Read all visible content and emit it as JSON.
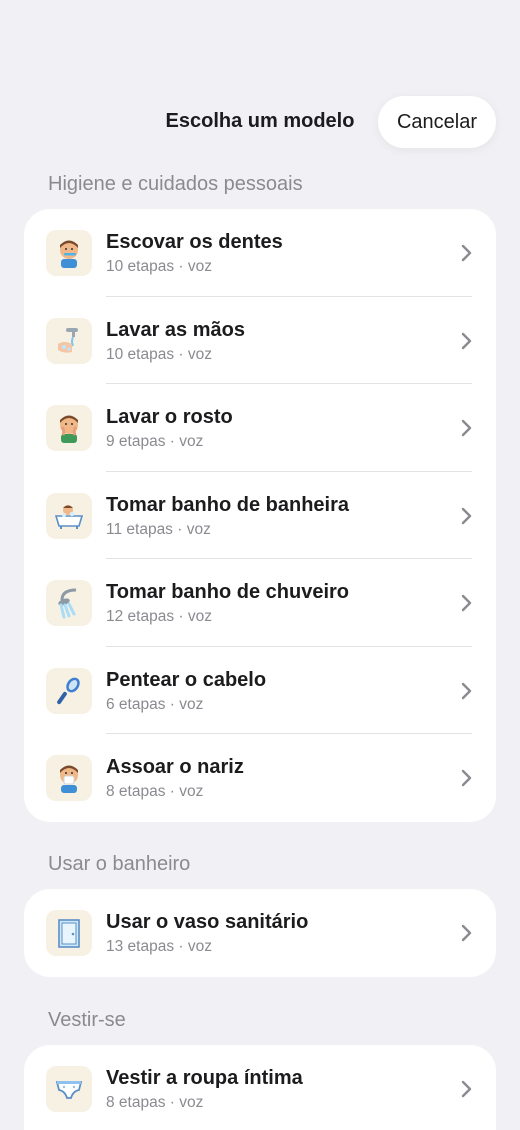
{
  "header": {
    "title": "Escolha um modelo",
    "cancel_label": "Cancelar"
  },
  "sections": [
    {
      "title": "Higiene e cuidados pessoais",
      "items": [
        {
          "title": "Escovar os dentes",
          "subtitle": "10 etapas · voz",
          "icon": "toothbrush-child-icon"
        },
        {
          "title": "Lavar as mãos",
          "subtitle": "10 etapas · voz",
          "icon": "hand-washing-icon"
        },
        {
          "title": "Lavar o rosto",
          "subtitle": "9 etapas · voz",
          "icon": "face-washing-child-icon"
        },
        {
          "title": "Tomar banho de banheira",
          "subtitle": "11 etapas · voz",
          "icon": "bathtub-child-icon"
        },
        {
          "title": "Tomar banho de chuveiro",
          "subtitle": "12 etapas · voz",
          "icon": "shower-head-icon"
        },
        {
          "title": "Pentear o cabelo",
          "subtitle": "6 etapas · voz",
          "icon": "hairbrush-icon"
        },
        {
          "title": "Assoar o nariz",
          "subtitle": "8 etapas · voz",
          "icon": "nose-blowing-child-icon"
        }
      ]
    },
    {
      "title": "Usar o banheiro",
      "items": [
        {
          "title": "Usar o vaso sanitário",
          "subtitle": "13 etapas · voz",
          "icon": "bathroom-door-icon"
        }
      ]
    },
    {
      "title": "Vestir-se",
      "items": [
        {
          "title": "Vestir a roupa íntima",
          "subtitle": "8 etapas · voz",
          "icon": "underwear-icon"
        }
      ]
    }
  ],
  "colors": {
    "background": "#f1f1f5",
    "card": "#ffffff",
    "text_primary": "#1c1c1e",
    "text_secondary": "#8a8a90",
    "icon_tile": "#f7f1e3"
  }
}
